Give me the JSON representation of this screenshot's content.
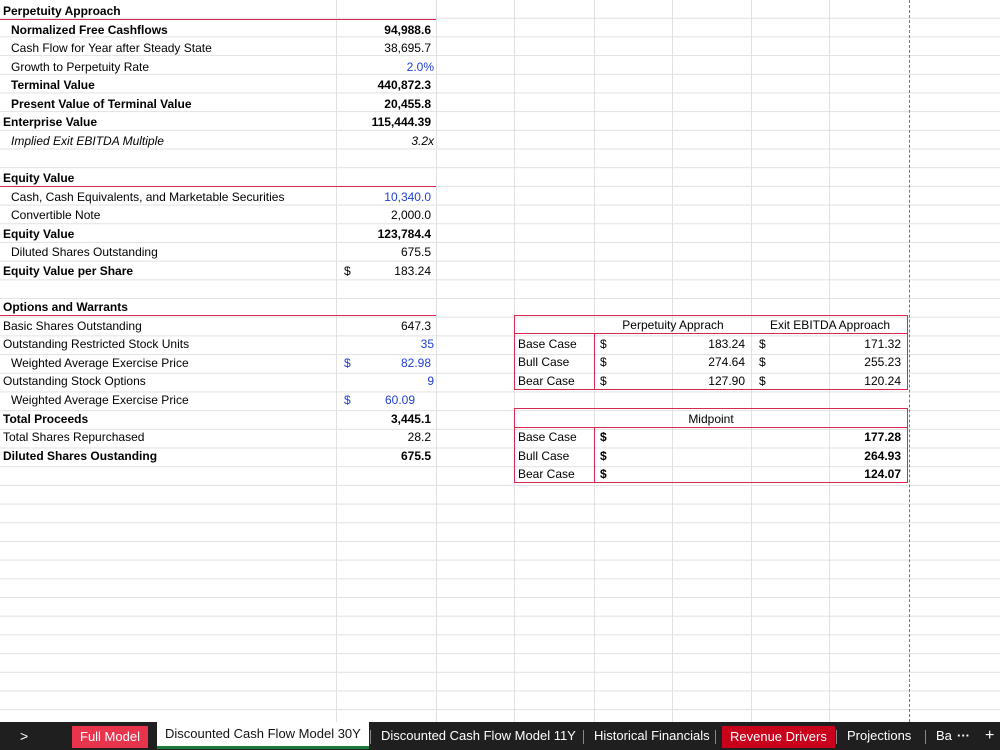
{
  "perpetuity": {
    "header": "Perpetuity Approach",
    "rows": [
      {
        "label": "Normalized Free Cashflows",
        "value": "94,988.6"
      },
      {
        "label": "Cash Flow for Year after Steady State",
        "value": "38,695.7"
      },
      {
        "label": "Growth to Perpetuity Rate",
        "value": "2.0%"
      },
      {
        "label": "Terminal Value",
        "value": "440,872.3"
      },
      {
        "label": "Present Value of Terminal Value",
        "value": "20,455.8"
      },
      {
        "label": "Enterprise Value",
        "value": "115,444.39"
      },
      {
        "label": "Implied Exit EBITDA Multiple",
        "value": "3.2x"
      }
    ]
  },
  "equity": {
    "header": "Equity Value",
    "rows": [
      {
        "label": "Cash, Cash Equivalents, and Marketable Securities",
        "value": "10,340.0"
      },
      {
        "label": "Convertible Note",
        "value": "2,000.0"
      },
      {
        "label": "Equity Value",
        "value": "123,784.4"
      },
      {
        "label": "Diluted Shares Outstanding",
        "value": "675.5"
      },
      {
        "label": "Equity Value per Share",
        "currency": "$",
        "value": "183.24"
      }
    ]
  },
  "options": {
    "header": "Options and Warrants",
    "rows": [
      {
        "label": "Basic Shares Outstanding",
        "value": "647.3"
      },
      {
        "label": "Outstanding Restricted Stock Units",
        "value": "35"
      },
      {
        "label": "Weighted Average Exercise Price",
        "currency": "$",
        "value": "82.98"
      },
      {
        "label": "Outstanding Stock Options",
        "value": "9"
      },
      {
        "label": "Weighted Average Exercise Price",
        "currency": "$",
        "value": "60.09"
      },
      {
        "label": "Total Proceeds",
        "value": "3,445.1"
      },
      {
        "label": "Total Shares Repurchased",
        "value": "28.2"
      },
      {
        "label": "Diluted Shares Oustanding",
        "value": "675.5"
      }
    ]
  },
  "scenarios": {
    "col1": "Perpetuity Apprach",
    "col2": "Exit EBITDA Approach",
    "currency": "$",
    "rows": [
      {
        "label": "Base Case",
        "perpetuity": "183.24",
        "exit": "171.32"
      },
      {
        "label": "Bull Case",
        "perpetuity": "274.64",
        "exit": "255.23"
      },
      {
        "label": "Bear Case",
        "perpetuity": "127.90",
        "exit": "120.24"
      }
    ]
  },
  "midpoint": {
    "header": "Midpoint",
    "currency": "$",
    "rows": [
      {
        "label": "Base Case",
        "value": "177.28"
      },
      {
        "label": "Bull Case",
        "value": "264.93"
      },
      {
        "label": "Bear Case",
        "value": "124.07"
      }
    ]
  },
  "tabs": {
    "scroll_left": ">",
    "items": [
      "Full Model",
      "Discounted Cash Flow Model 30Y",
      "Discounted Cash Flow Model 11Y",
      "Historical Financials",
      "Revenue Drivers",
      "Projections",
      "Ba"
    ],
    "more": "···",
    "add": "+"
  },
  "colors": {
    "accent_red": "#d8284d",
    "blue_input": "#1f3fd1",
    "active_tab_underline": "#1e7a3e"
  }
}
